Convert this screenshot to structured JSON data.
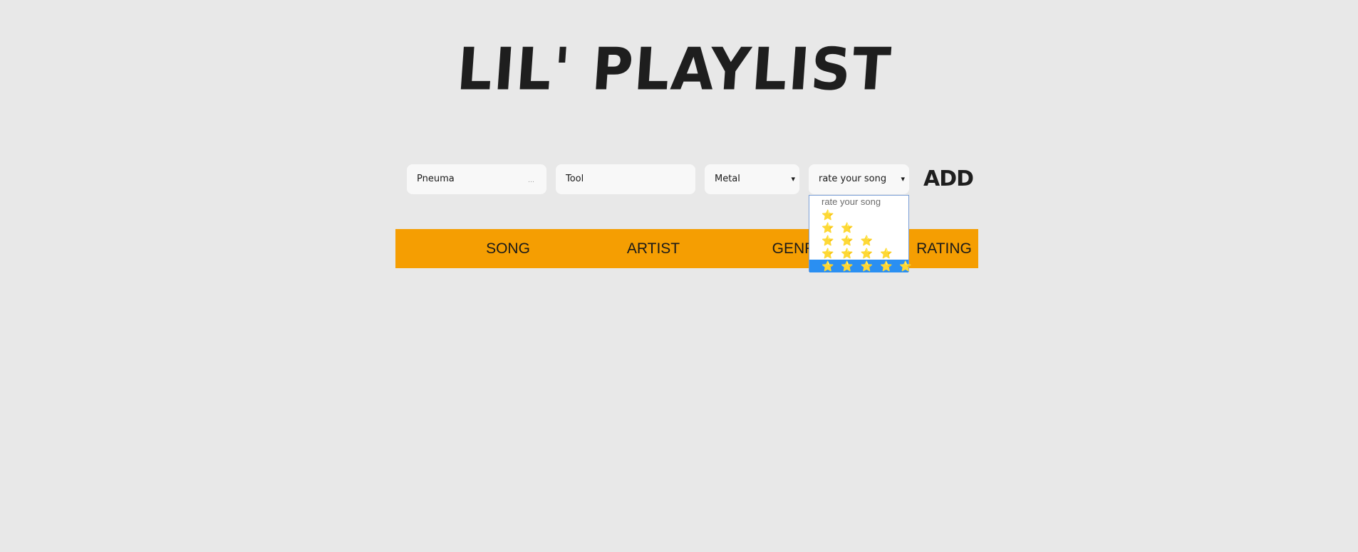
{
  "title": "LIL' PLAYLIST",
  "form": {
    "song_value": "Pneuma",
    "artist_value": "Tool",
    "genre_value": "Metal",
    "rating_value": "rate your song",
    "add_label": "ADD"
  },
  "icons": {
    "autofill": "…",
    "dropdown_caret": "▾",
    "star": "⭐"
  },
  "table": {
    "headers": [
      "SONG",
      "ARTIST",
      "GENRE",
      "RATING"
    ]
  },
  "rating_dropdown": {
    "options": [
      {
        "label": "rate your song",
        "stars": 0
      },
      {
        "label": "⭐",
        "stars": 1
      },
      {
        "label": "⭐ ⭐",
        "stars": 2
      },
      {
        "label": "⭐ ⭐ ⭐",
        "stars": 3
      },
      {
        "label": "⭐ ⭐ ⭐ ⭐",
        "stars": 4
      },
      {
        "label": "⭐ ⭐ ⭐ ⭐ ⭐",
        "stars": 5
      }
    ],
    "highlighted_index": 5
  },
  "colors": {
    "background": "#e8e8e8",
    "header_bar": "#f59e02",
    "highlight": "#2a8ff2",
    "star": "#f2c21a"
  }
}
